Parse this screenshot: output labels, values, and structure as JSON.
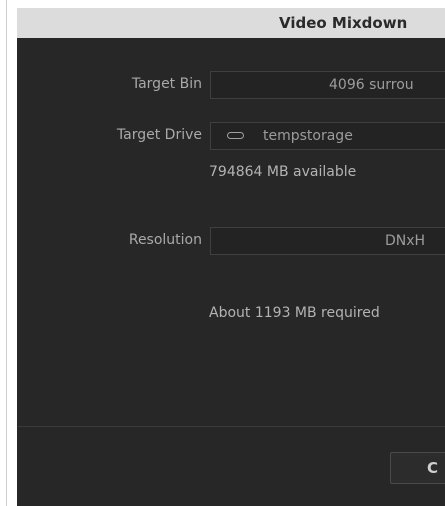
{
  "dialog": {
    "title": "Video Mixdown"
  },
  "target_bin": {
    "label": "Target Bin",
    "value": "4096 surrou"
  },
  "target_drive": {
    "label": "Target Drive",
    "icon": "drive-icon",
    "value": "tempstorage",
    "available": "794864 MB available"
  },
  "resolution": {
    "label": "Resolution",
    "value": "DNxH"
  },
  "required": {
    "text": "About 1193 MB required"
  },
  "footer": {
    "button_label": "C"
  }
}
